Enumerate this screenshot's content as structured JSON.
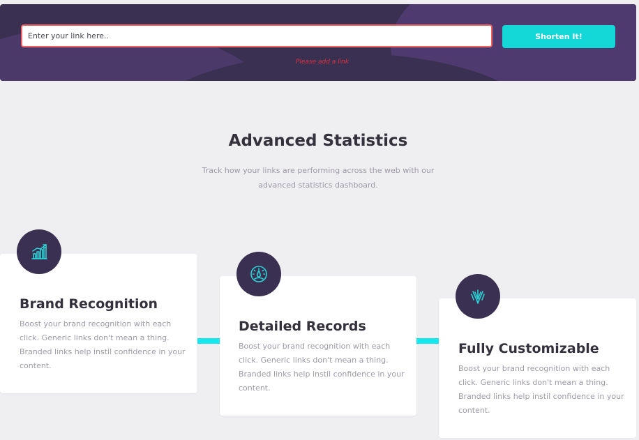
{
  "shortener": {
    "input_placeholder": "Enter your link here..",
    "button_label": "Shorten It!",
    "error_message": "Please add a link"
  },
  "stats_section": {
    "title": "Advanced Statistics",
    "description": "Track how your links are performing across the web with our advanced statistics dashboard."
  },
  "features": [
    {
      "title": "Brand Recognition",
      "text": "Boost your brand recognition with each click. Generic links don't mean a thing. Branded links help instil confidence in your content.",
      "icon": "bar-chart-icon"
    },
    {
      "title": "Detailed Records",
      "text": "Boost your brand recognition with each click. Generic links don't mean a thing. Branded links help instil confidence in your content.",
      "icon": "speedometer-icon"
    },
    {
      "title": "Fully Customizable",
      "text": "Boost your brand recognition with each click. Generic links don't mean a thing. Branded links help instil confidence in your content.",
      "icon": "brush-icon"
    }
  ],
  "colors": {
    "accent": "#14d7d8",
    "dark_violet": "#3a3052",
    "error": "#f46262",
    "background": "#efeef0"
  }
}
